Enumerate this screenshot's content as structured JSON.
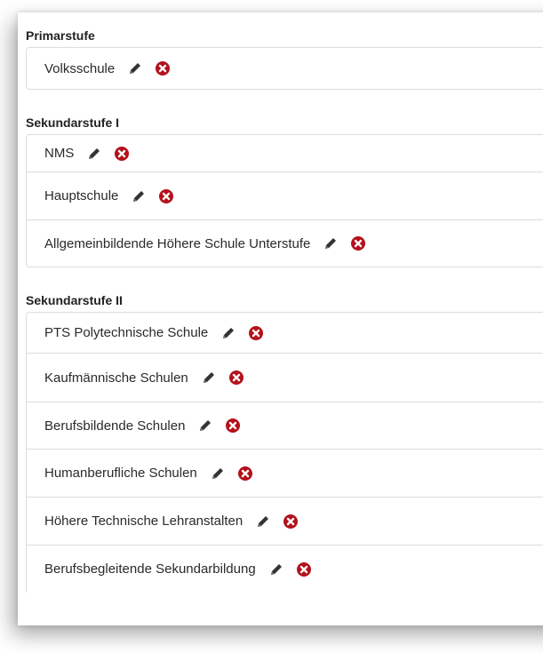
{
  "groups": [
    {
      "title": "Primarstufe",
      "items": [
        "Volksschule"
      ]
    },
    {
      "title": "Sekundarstufe I",
      "items": [
        "NMS",
        "Hauptschule",
        "Allgemeinbildende Höhere Schule Unterstufe"
      ]
    },
    {
      "title": "Sekundarstufe II",
      "items": [
        "PTS Polytechnische Schule",
        "Kaufmännische Schulen",
        "Berufsbildende Schulen",
        "Humanberufliche Schulen",
        "Höhere Technische Lehranstalten",
        "Berufsbegleitende Sekundarbildung"
      ]
    }
  ],
  "icons": {
    "edit": "pencil-icon",
    "delete": "delete-icon",
    "delete_color": "#b3121c"
  }
}
